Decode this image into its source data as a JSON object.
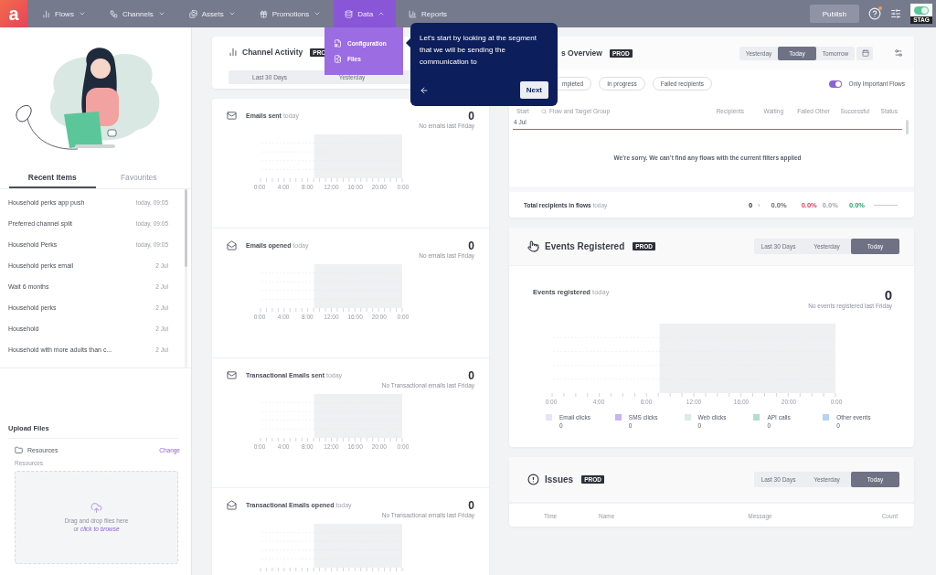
{
  "logo": "a",
  "nav": [
    {
      "label": "Flows",
      "kind": "menu",
      "expanded": false,
      "selected": false
    },
    {
      "label": "Channels",
      "kind": "menu",
      "expanded": false,
      "selected": false
    },
    {
      "label": "Assets",
      "kind": "menu",
      "expanded": false,
      "selected": false
    },
    {
      "label": "Promotions",
      "kind": "menu",
      "expanded": false,
      "selected": false
    },
    {
      "label": "Data",
      "kind": "menu",
      "expanded": true,
      "selected": true
    },
    {
      "label": "Reports",
      "kind": "link",
      "selected": false
    }
  ],
  "publish": "Publish",
  "workspace": "STAG",
  "data_menu": [
    "Configuration",
    "Files"
  ],
  "tour": {
    "text": "Let’s start by looking at the segment that we will be sending the communication to",
    "next": "Next"
  },
  "left": {
    "tabs": [
      {
        "label": "Recent Items",
        "selected": true
      },
      {
        "label": "Favourites",
        "selected": false
      }
    ],
    "recent": [
      {
        "name": "Household perks app push",
        "date": "today, 09:05"
      },
      {
        "name": "Preferred channel split",
        "date": "today, 09:05"
      },
      {
        "name": "Household Perks",
        "date": "today, 09:05"
      },
      {
        "name": "Household perks email",
        "date": "2 Jul"
      },
      {
        "name": "Wait 6 months",
        "date": "2 Jul"
      },
      {
        "name": "Household perks",
        "date": "2 Jul"
      },
      {
        "name": "Household",
        "date": "2 Jul"
      },
      {
        "name": "Household with more adults than c...",
        "date": "2 Jul"
      }
    ],
    "upload": {
      "title": "Upload Files",
      "folder": "Resources",
      "change": "Change",
      "label": "Resources",
      "drop": "Drag and drop files here",
      "or": "or",
      "browse": "click to browse"
    }
  },
  "channel_activity": {
    "title": "Channel Activity",
    "badge": "PRO",
    "tabs": [
      {
        "label": "Last 30 Days",
        "selected": false
      },
      {
        "label": "Yesterday",
        "selected": false
      }
    ],
    "sections": [
      {
        "kind": "sent",
        "title": "Emails sent",
        "period": "today",
        "count": "0",
        "note": "No emails last Friday",
        "x_labels": [
          "0:00",
          "4:00",
          "8:00",
          "12:00",
          "16:00",
          "20:00",
          "0:00"
        ]
      },
      {
        "kind": "opened",
        "title": "Emails opened",
        "period": "today",
        "count": "0",
        "note": "No emails last Friday",
        "x_labels": [
          "0:00",
          "4:00",
          "8:00",
          "12:00",
          "16:00",
          "20:00",
          "0:00"
        ]
      },
      {
        "kind": "sent",
        "title": "Transactional Emails sent",
        "period": "today",
        "count": "0",
        "note": "No Transactional emails last Friday",
        "x_labels": [
          "0:00",
          "4:00",
          "8:00",
          "12:00",
          "16:00",
          "20:00",
          "0:00"
        ]
      },
      {
        "kind": "opened",
        "title": "Transactional Emails opened",
        "period": "today",
        "count": "0",
        "note": "No Transactional emails last Friday"
      }
    ]
  },
  "flows": {
    "title": "s Overview",
    "badge": "PROD",
    "tabs": [
      {
        "label": "Yesterday",
        "selected": false
      },
      {
        "label": "Today",
        "selected": true
      },
      {
        "label": "Tomorrow",
        "selected": false
      }
    ],
    "filters": [
      "mpleted",
      "In progress",
      "Failed recipients"
    ],
    "toggle": {
      "label": "Only Important Flows",
      "on": true
    },
    "columns": [
      "Start",
      "Flow and Target Group",
      "Recipients",
      "Waiting",
      "Failed Other",
      "Successful",
      "Status"
    ],
    "group": "4 Jul",
    "empty": "We’re sorry. We can’t find any flows with the current filters applied",
    "total": {
      "label": "Total recipients in flows",
      "period": "today",
      "count": "0",
      "arrow": "›",
      "stats": [
        {
          "value": "0.0%",
          "color": "#6b6e7a"
        },
        {
          "value": "0.0%",
          "color": "#d9455f"
        },
        {
          "value": "0.0%",
          "color": "#a3a5b0"
        },
        {
          "value": "0.0%",
          "color": "#2e9e6a"
        }
      ]
    }
  },
  "events": {
    "title": "Events Registered",
    "badge": "PROD",
    "tabs": [
      {
        "label": "Last 30 Days",
        "selected": false
      },
      {
        "label": "Yesterday",
        "selected": false
      },
      {
        "label": "Today",
        "selected": true
      }
    ],
    "metric": {
      "title": "Events registered",
      "period": "today",
      "count": "0",
      "note": "No events registered last Friday"
    },
    "x_labels": [
      "0:00",
      "4:00",
      "8:00",
      "12:00",
      "16:00",
      "20:00",
      "0:00"
    ],
    "legend": [
      {
        "label": "Email clicks",
        "value": "0",
        "color": "#e8e4f7"
      },
      {
        "label": "SMS clicks",
        "value": "0",
        "color": "#c7b5f2"
      },
      {
        "label": "Web clicks",
        "value": "0",
        "color": "#dcebe5"
      },
      {
        "label": "API calls",
        "value": "0",
        "color": "#b3dfca"
      },
      {
        "label": "Other events",
        "value": "0",
        "color": "#b8d2f3"
      }
    ]
  },
  "issues": {
    "title": "Issues",
    "badge": "PROD",
    "tabs": [
      {
        "label": "Last 30 Days",
        "selected": false
      },
      {
        "label": "Yesterday",
        "selected": false
      },
      {
        "label": "Today",
        "selected": true
      }
    ],
    "columns": [
      "Time",
      "Name",
      "Message",
      "Count"
    ]
  }
}
